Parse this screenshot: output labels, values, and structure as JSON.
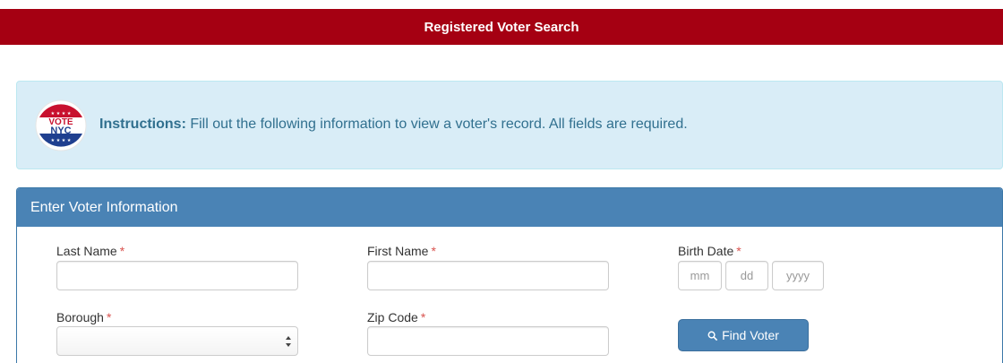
{
  "header": {
    "title": "Registered Voter Search"
  },
  "instructions": {
    "badge_top_text": "VOTE",
    "badge_bottom_text": "NYC",
    "label": "Instructions:",
    "text": "Fill out the following information to view a voter's record. All fields are required."
  },
  "panel": {
    "title": "Enter Voter Information",
    "required_marker": "*",
    "fields": {
      "last_name": {
        "label": "Last Name",
        "value": ""
      },
      "first_name": {
        "label": "First Name",
        "value": ""
      },
      "birth_date": {
        "label": "Birth Date",
        "mm_placeholder": "mm",
        "dd_placeholder": "dd",
        "yyyy_placeholder": "yyyy"
      },
      "borough": {
        "label": "Borough",
        "selected": ""
      },
      "zip_code": {
        "label": "Zip Code",
        "value": ""
      }
    },
    "submit": {
      "label": "Find Voter",
      "icon": "search-icon"
    }
  },
  "colors": {
    "header_bg": "#a50012",
    "panel_header_bg": "#4a83b5",
    "instructions_bg": "#d9edf7",
    "required": "#d9534f"
  }
}
